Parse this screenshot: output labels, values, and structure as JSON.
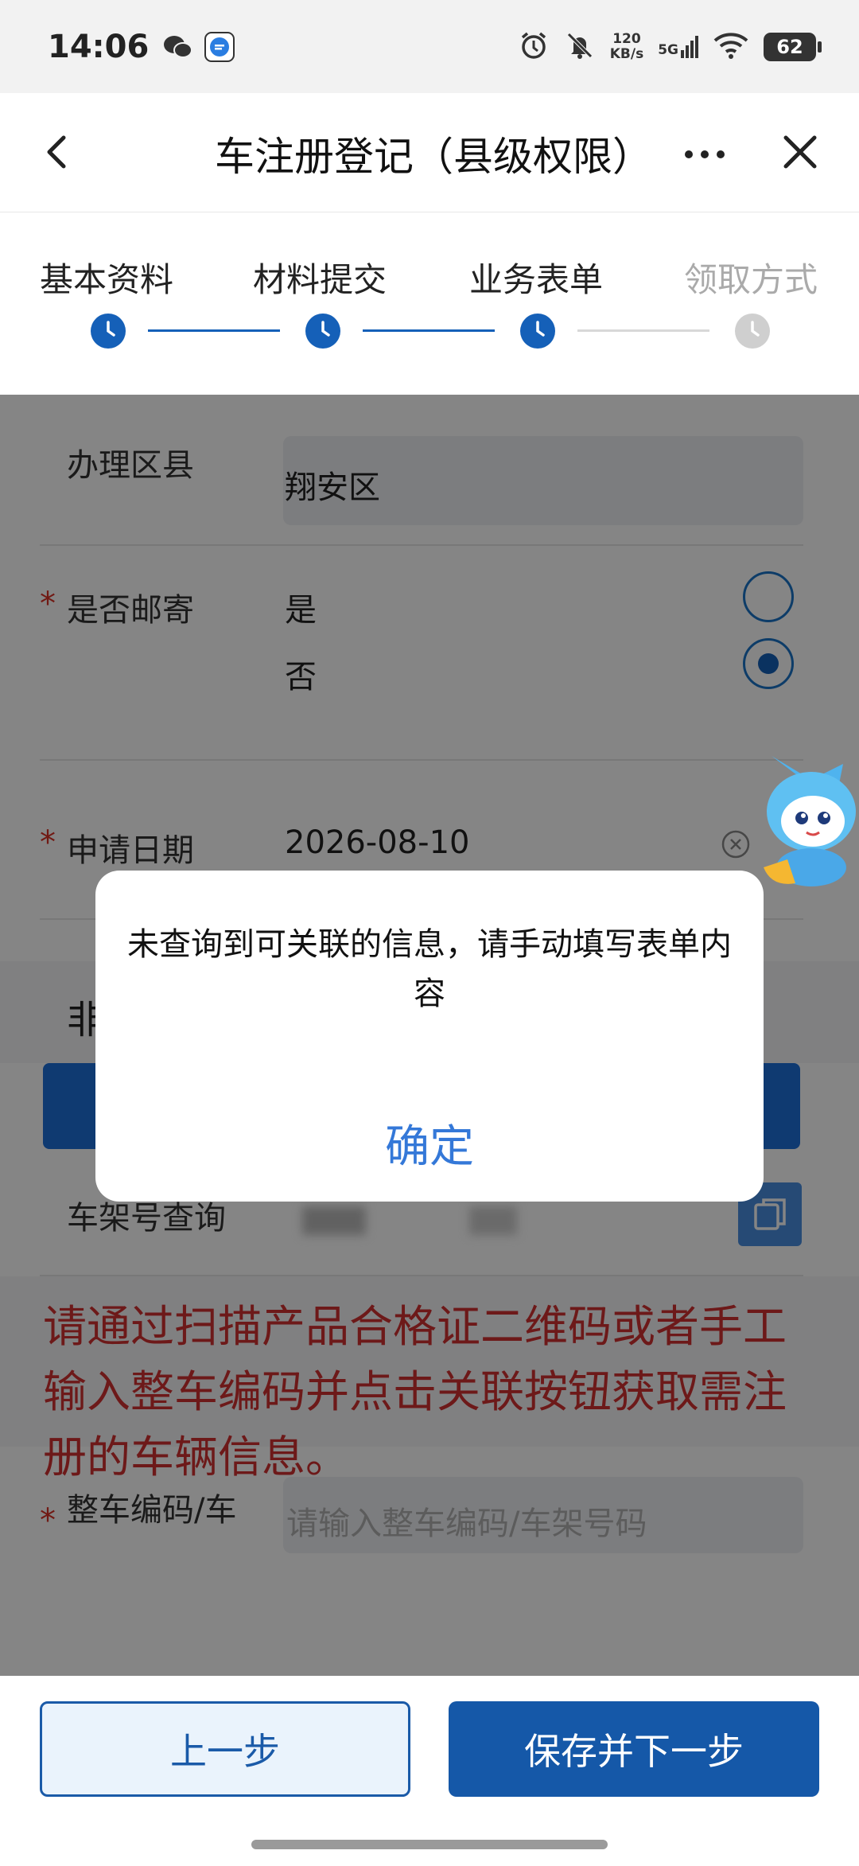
{
  "status_bar": {
    "time": "14:06",
    "net_speed": "120",
    "net_unit": "KB/s",
    "signal": "5G",
    "battery": "62",
    "icons": [
      "wechat-icon",
      "message-app-icon",
      "alarm-icon",
      "mute-icon",
      "signal-icon",
      "wifi-icon",
      "battery-icon"
    ]
  },
  "nav": {
    "title": "车注册登记（县级权限）",
    "icons": [
      "back-icon",
      "more-icon",
      "close-icon"
    ]
  },
  "stepper": {
    "steps": [
      {
        "label": "基本资料",
        "state": "done"
      },
      {
        "label": "材料提交",
        "state": "done"
      },
      {
        "label": "业务表单",
        "state": "current"
      },
      {
        "label": "领取方式",
        "state": "pending"
      }
    ],
    "colors": {
      "active": "#1560b8",
      "inactive": "#cfcfcf"
    }
  },
  "form": {
    "district": {
      "label": "办理区县",
      "value": "翔安区"
    },
    "mail": {
      "label": "是否邮寄",
      "options": [
        "是",
        "否"
      ],
      "selected": "否"
    },
    "apply_date": {
      "label": "申请日期",
      "value": "2026-08-10"
    },
    "section_title": "非",
    "vin_query_label": "车架号查询",
    "warning": "请通过扫描产品合格证二维码或者手工输入整车编码并点击关联按钮获取需注册的车辆信息。",
    "vehicle_code": {
      "label": "整车编码/车",
      "placeholder": "请输入整车编码/车架号码"
    }
  },
  "dialog": {
    "message": "未查询到可关联的信息，请手动填写表单内容",
    "confirm": "确定"
  },
  "bottom": {
    "prev": "上一步",
    "next": "保存并下一步"
  }
}
